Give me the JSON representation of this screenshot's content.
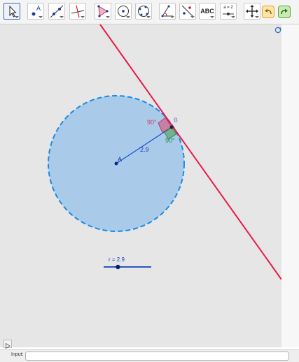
{
  "toolbar": {
    "tools": [
      {
        "name": "move-tool",
        "icon": "arrow-cursor-icon",
        "selected": true
      },
      {
        "name": "point-tool",
        "icon": "point-icon",
        "text": "A"
      },
      {
        "name": "line-tool",
        "icon": "line-through-points-icon"
      },
      {
        "name": "perpendicular-line-tool",
        "icon": "perpendicular-line-icon"
      },
      {
        "name": "polygon-tool",
        "icon": "polygon-icon"
      },
      {
        "name": "circle-center-point-tool",
        "icon": "circle-center-icon"
      },
      {
        "name": "conic-tool",
        "icon": "conic-five-points-icon"
      },
      {
        "name": "angle-tool",
        "icon": "angle-icon"
      },
      {
        "name": "reflect-tool",
        "icon": "reflect-about-line-icon"
      },
      {
        "name": "text-tool",
        "icon": "text-icon",
        "text": "ABC"
      },
      {
        "name": "slider-tool",
        "icon": "slider-icon",
        "text": "a = 2"
      },
      {
        "name": "move-graphics-view-tool",
        "icon": "move-view-icon"
      }
    ],
    "undo": {
      "icon": "undo-icon",
      "color": "#f2c14e"
    },
    "redo": {
      "icon": "redo-icon",
      "color": "#5fb33f"
    }
  },
  "graphics": {
    "circle": {
      "center_label": "A",
      "radius_label": "2.9",
      "fill": "#a9cbe9",
      "stroke": "#1a8be3"
    },
    "point_b_label": "B",
    "tangent_line_color": "#e8194b",
    "angle_1": {
      "label": "90°",
      "color": "#d6336c"
    },
    "angle_2": {
      "label": "90°",
      "color": "#1f8a3a"
    },
    "slider": {
      "name": "r",
      "value": "2.9",
      "label": "r = 2.9",
      "fraction": 0.3,
      "color": "#1440b8"
    }
  },
  "input_bar": {
    "label": "Input:",
    "value": "",
    "placeholder": ""
  }
}
